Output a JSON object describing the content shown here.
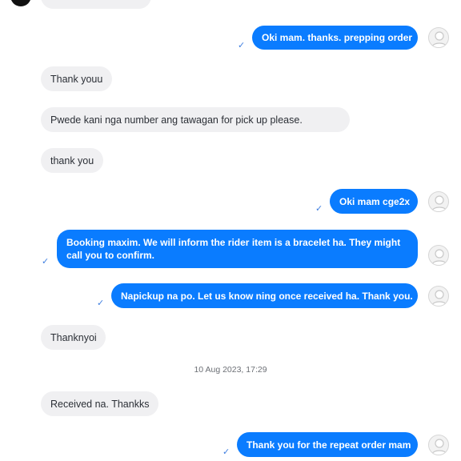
{
  "messages": [
    {
      "text": "Oki mam. thanks. prepping order"
    },
    {
      "text": "Thank youu"
    },
    {
      "text": "Pwede kani nga number ang tawagan for pick up please."
    },
    {
      "text": "thank you"
    },
    {
      "text": "Oki mam cge2x"
    },
    {
      "text": "Booking maxim. We will inform the rider item is a bracelet ha. They might call you to confirm."
    },
    {
      "text": "Napickup na po. Let us know ning once received ha. Thank you."
    },
    {
      "text": "Thanknyoi"
    },
    {
      "text": "Received na. Thankks"
    },
    {
      "text": "Thank you for the repeat order mam"
    }
  ],
  "date_separator": "10 Aug 2023, 17:29",
  "icons": {
    "read_receipt": "check-icon",
    "avatar": "default-user-avatar"
  },
  "colors": {
    "outgoing_bubble": "#0a7cff",
    "incoming_bubble": "#f0f0f2",
    "read_check": "#3f7fe0"
  }
}
